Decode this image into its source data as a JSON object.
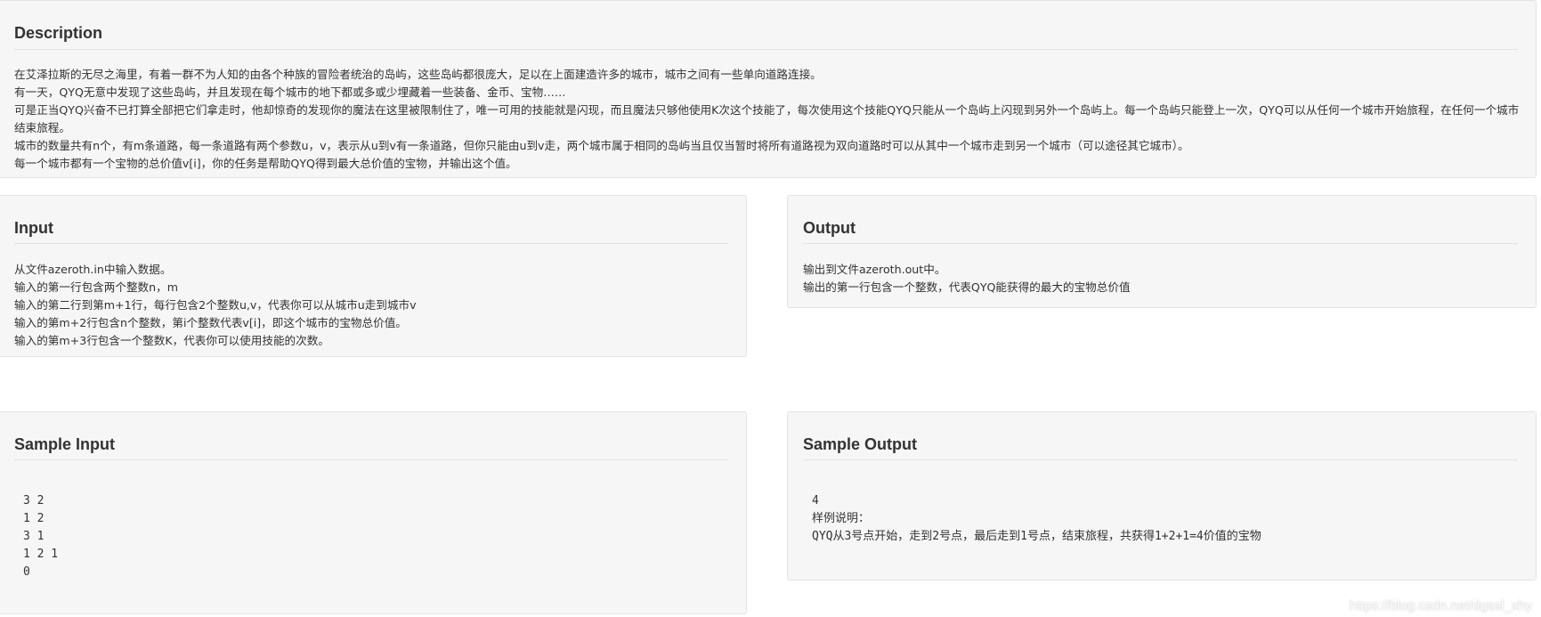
{
  "description": {
    "title": "Description",
    "lines": [
      "在艾泽拉斯的无尽之海里，有着一群不为人知的由各个种族的冒险者统治的岛屿，这些岛屿都很庞大，足以在上面建造许多的城市，城市之间有一些单向道路连接。",
      "有一天，QYQ无意中发现了这些岛屿，并且发现在每个城市的地下都或多或少埋藏着一些装备、金币、宝物……",
      "可是正当QYQ兴奋不已打算全部把它们拿走时，他却惊奇的发现你的魔法在这里被限制住了，唯一可用的技能就是闪现，而且魔法只够他使用K次这个技能了，每次使用这个技能QYQ只能从一个岛屿上闪现到另外一个岛屿上。每一个岛屿只能登上一次，QYQ可以从任何一个城市开始旅程，在任何一个城市结束旅程。",
      "城市的数量共有n个，有m条道路，每一条道路有两个参数u，v，表示从u到v有一条道路，但你只能由u到v走，两个城市属于相同的岛屿当且仅当暂时将所有道路视为双向道路时可以从其中一个城市走到另一个城市（可以途径其它城市）。",
      "每一个城市都有一个宝物的总价值v[i]，你的任务是帮助QYQ得到最大总价值的宝物，并输出这个值。"
    ]
  },
  "input": {
    "title": "Input",
    "lines": [
      "从文件azeroth.in中输入数据。",
      "输入的第一行包含两个整数n，m",
      "输入的第二行到第m+1行，每行包含2个整数u,v，代表你可以从城市u走到城市v",
      "输入的第m+2行包含n个整数，第i个整数代表v[i]，即这个城市的宝物总价值。",
      "输入的第m+3行包含一个整数K，代表你可以使用技能的次数。"
    ]
  },
  "output": {
    "title": "Output",
    "lines": [
      "输出到文件azeroth.out中。",
      "输出的第一行包含一个整数，代表QYQ能获得的最大的宝物总价值"
    ]
  },
  "sample_input": {
    "title": "Sample Input",
    "lines": [
      "3 2",
      "1 2",
      "3 1",
      "1 2 1",
      "0"
    ]
  },
  "sample_output": {
    "title": "Sample Output",
    "lines": [
      "4",
      "样例说明：",
      "QYQ从3号点开始，走到2号点，最后走到1号点，结束旅程，共获得1+2+1=4价值的宝物"
    ]
  },
  "watermark": "https://blog.csdn.net/dgssl_xhy"
}
